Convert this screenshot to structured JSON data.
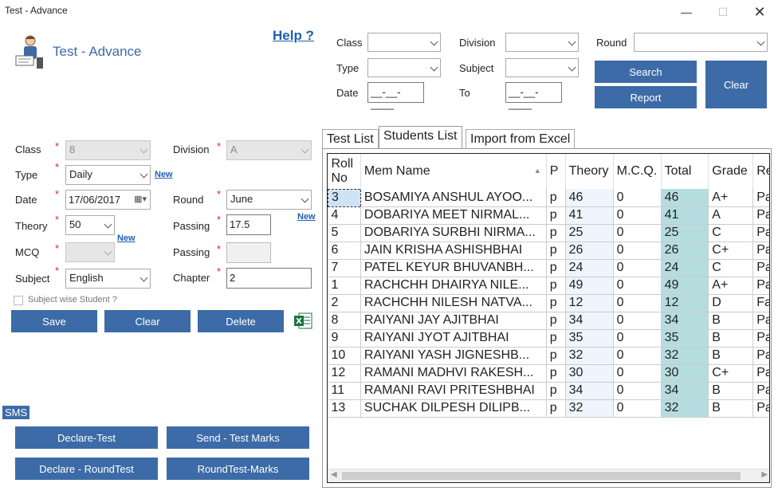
{
  "window": {
    "title": "Test - Advance"
  },
  "header": {
    "app_title": "Test - Advance",
    "help": "Help ?"
  },
  "filter": {
    "class_label": "Class",
    "division_label": "Division",
    "round_label": "Round",
    "type_label": "Type",
    "subject_label": "Subject",
    "date_label": "Date",
    "to_label": "To",
    "date_value": "__-__-____",
    "to_value": "__-__-____",
    "search": "Search",
    "report": "Report",
    "clear": "Clear"
  },
  "form": {
    "class_label": "Class",
    "class_value": "8",
    "division_label": "Division",
    "division_value": "A",
    "type_label": "Type",
    "type_value": "Daily",
    "new": "New",
    "date_label": "Date",
    "date_value": "17/06/2017",
    "round_label": "Round",
    "round_value": "June",
    "theory_label": "Theory",
    "theory_value": "50",
    "passing_label": "Passing",
    "passing_value": "17.5",
    "mcq_label": "MCQ",
    "mcq_value": "",
    "passing2_label": "Passing",
    "passing2_value": "",
    "subject_label": "Subject",
    "subject_value": "English",
    "chapter_label": "Chapter",
    "chapter_value": "2",
    "subject_wise": "Subject wise Student ?",
    "save": "Save",
    "clear": "Clear",
    "delete": "Delete"
  },
  "sms": {
    "label": "SMS",
    "declare_test": "Declare-Test",
    "send_test_marks": "Send - Test Marks",
    "declare_round": "Declare - RoundTest",
    "round_marks": "RoundTest-Marks"
  },
  "tabs": [
    "Test List",
    "Students List",
    "Import from Excel"
  ],
  "grid": {
    "headers": [
      "Roll No",
      "Mem Name",
      "P",
      "Theory",
      "M.C.Q.",
      "Total",
      "Grade",
      "Re"
    ],
    "rows": [
      [
        "3",
        "BOSAMIYA ANSHUL AYOO...",
        "p",
        "46",
        "0",
        "46",
        "A+",
        "Pa"
      ],
      [
        "4",
        "DOBARIYA MEET NIRMAL...",
        "p",
        "41",
        "0",
        "41",
        "A",
        "Pa"
      ],
      [
        "5",
        "DOBARIYA SURBHI NIRMA...",
        "p",
        "25",
        "0",
        "25",
        "C",
        "Pa"
      ],
      [
        "6",
        "JAIN KRISHA ASHISHBHAI",
        "p",
        "26",
        "0",
        "26",
        "C+",
        "Pa"
      ],
      [
        "7",
        "PATEL KEYUR BHUVANBH...",
        "p",
        "24",
        "0",
        "24",
        "C",
        "Pa"
      ],
      [
        "1",
        "RACHCHH DHAIRYA NILE...",
        "p",
        "49",
        "0",
        "49",
        "A+",
        "Pa"
      ],
      [
        "2",
        "RACHCHH NILESH NATVA...",
        "p",
        "12",
        "0",
        "12",
        "D",
        "Fa"
      ],
      [
        "8",
        "RAIYANI JAY AJITBHAI",
        "p",
        "34",
        "0",
        "34",
        "B",
        "Pa"
      ],
      [
        "9",
        "RAIYANI JYOT AJITBHAI",
        "p",
        "35",
        "0",
        "35",
        "B",
        "Pa"
      ],
      [
        "10",
        "RAIYANI YASH JIGNESHB...",
        "p",
        "32",
        "0",
        "32",
        "B",
        "Pa"
      ],
      [
        "12",
        "RAMANI MADHVI RAKESH...",
        "p",
        "30",
        "0",
        "30",
        "C+",
        "Pa"
      ],
      [
        "11",
        "RAMANI RAVI PRITESHBHAI",
        "p",
        "34",
        "0",
        "34",
        "B",
        "Pa"
      ],
      [
        "13",
        "SUCHAK DILPESH DILIPB...",
        "p",
        "32",
        "0",
        "32",
        "B",
        "Pa"
      ]
    ]
  }
}
